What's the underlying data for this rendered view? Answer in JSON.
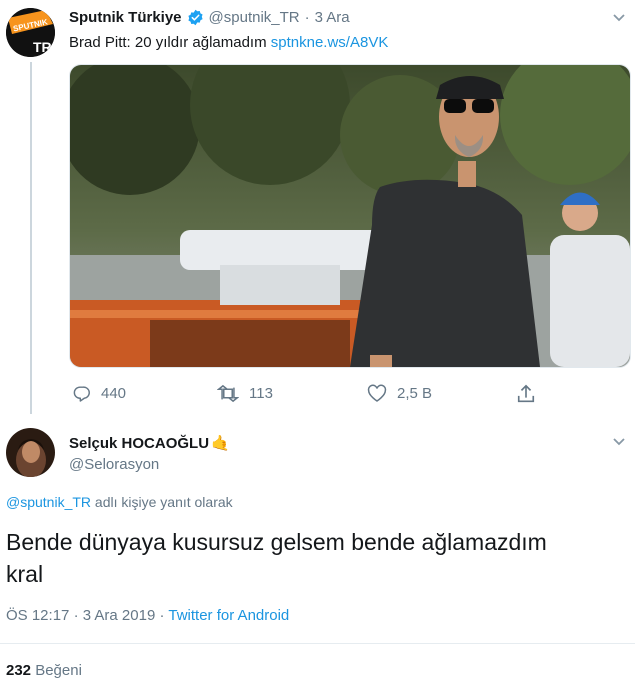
{
  "tweet1": {
    "author_name": "Sputnik Türkiye",
    "handle": "@sputnik_TR",
    "dot": "·",
    "date": "3 Ara",
    "text": "Brad Pitt: 20 yıldır ağlamadım",
    "link": "sptnkne.ws/A8VK",
    "avatar_top": "SPUTNIK",
    "avatar_bottom": "TR",
    "actions": {
      "replies": "440",
      "retweets": "113",
      "likes": "2,5 B"
    }
  },
  "tweet2": {
    "author_name": "Selçuk HOCAOĞLU",
    "author_emoji": "🤙",
    "handle": "@Selorasyon",
    "reply_to_handle": "@sputnik_TR",
    "reply_to_suffix": "adlı kişiye yanıt olarak",
    "text_line1": "Bende dünyaya kusursuz gelsem bende ağlamazdım",
    "text_line2": "kral",
    "time": "ÖS 12:17",
    "date": "3 Ara 2019",
    "dot": "·",
    "source": "Twitter for Android",
    "likes_count": "232",
    "likes_label": "Beğeni"
  },
  "colors": {
    "link_blue": "#1b95e0",
    "muted": "#657786",
    "verified": "#1da1f2",
    "sputnik_orange": "#f7941d"
  },
  "icons": [
    "verified-badge-icon",
    "chevron-down-icon",
    "reply-icon",
    "retweet-icon",
    "like-icon",
    "share-icon"
  ]
}
